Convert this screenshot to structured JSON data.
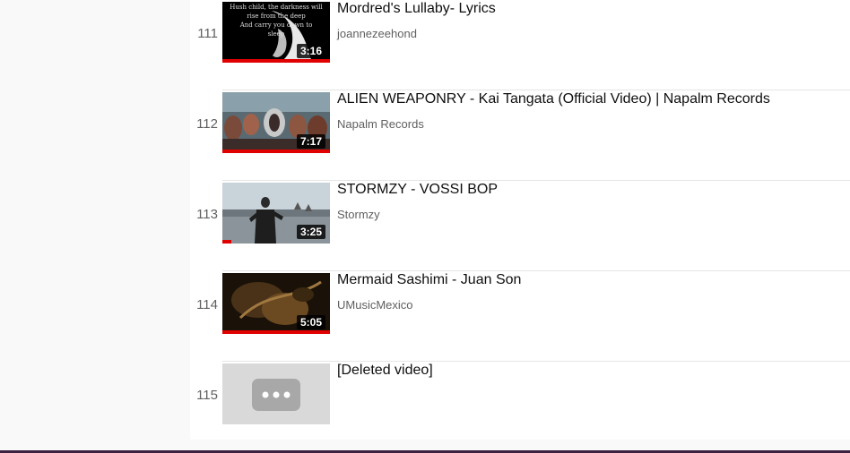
{
  "playlist": {
    "items": [
      {
        "index": "111",
        "title": "Mordred's Lullaby- Lyrics",
        "channel": "joannezeehond",
        "duration": "3:16",
        "watched_progress": 1.0,
        "thumb_text": [
          "Hush child, the darkness will",
          "rise from the deep",
          "And carry you down to",
          "sleep"
        ]
      },
      {
        "index": "112",
        "title": "ALIEN WEAPONRY - Kai Tangata (Official Video) | Napalm Records",
        "channel": "Napalm Records",
        "duration": "7:17",
        "watched_progress": 1.0
      },
      {
        "index": "113",
        "title": "STORMZY - VOSSI BOP",
        "channel": "Stormzy",
        "duration": "3:25",
        "watched_progress": 0.08
      },
      {
        "index": "114",
        "title": "Mermaid Sashimi - Juan Son",
        "channel": "UMusicMexico",
        "duration": "5:05",
        "watched_progress": 1.0
      },
      {
        "index": "115",
        "title": "[Deleted video]",
        "channel": "",
        "duration": "",
        "watched_progress": 0
      }
    ]
  },
  "colors": {
    "progress": "#e00000",
    "separator": "#e5e5e5",
    "accent_bar": "#3d2140"
  }
}
